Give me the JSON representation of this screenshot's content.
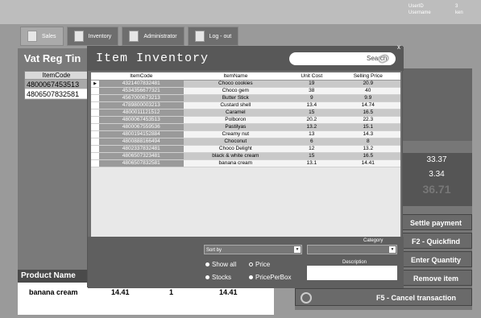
{
  "user": {
    "userid_label": "UserID",
    "userid": "3",
    "username_label": "Username",
    "username": "ken"
  },
  "nav": [
    {
      "label": "Sales",
      "icon": "document-icon"
    },
    {
      "label": "Inventory",
      "icon": "cart-icon"
    },
    {
      "label": "Administrator",
      "icon": "user-icon"
    },
    {
      "label": "Log - out",
      "icon": "logout-icon"
    }
  ],
  "left": {
    "title": "Vat Reg Tin",
    "header": "ItemCode",
    "rows": [
      "4800067453513",
      "4806507832581"
    ]
  },
  "modal": {
    "title": "Item Inventory",
    "close": "x",
    "search_placeholder": "Search",
    "columns": [
      "ItemCode",
      "ItemName",
      "Unit Cost",
      "Selling Price"
    ],
    "rows": [
      [
        "4321407832481",
        "Choco cookies",
        "19",
        "20.9"
      ],
      [
        "4534356677321",
        "Choco gem",
        "38",
        "40"
      ],
      [
        "4567000673213",
        "Butter Stick",
        "9",
        "9.9"
      ],
      [
        "4789800003213",
        "Custard shell",
        "13.4",
        "14.74"
      ],
      [
        "4800011121512",
        "Caramel",
        "15",
        "16.5"
      ],
      [
        "4800067453513",
        "Polboron",
        "20.2",
        "22.3"
      ],
      [
        "4800067559536",
        "Pastilyas",
        "13.2",
        "15.1"
      ],
      [
        "4800194152884",
        "Creamy nut",
        "13",
        "14.3"
      ],
      [
        "4800888166494",
        "Choconut",
        "6",
        "8"
      ],
      [
        "4802337832481",
        "Choco Delight",
        "12",
        "13.2"
      ],
      [
        "4806507323481",
        "black & white cream",
        "15",
        "16.5"
      ],
      [
        "4806507832581",
        "banana cream",
        "13.1",
        "14.41"
      ]
    ],
    "sort_label": "Sort by",
    "category_label": "Category",
    "description_label": "Description",
    "radios": [
      "Show all",
      "Price",
      "Stocks",
      "PricePerBox"
    ]
  },
  "product": {
    "header": "Product Name",
    "name": "banana cream",
    "price": "14.41",
    "qty": "1",
    "total": "14.41"
  },
  "totals": {
    "a": "33.37",
    "b": "3.34",
    "c": "36.71"
  },
  "actions": [
    "Settle payment",
    "F2 - Quickfind",
    "Enter Quantity",
    "Remove item"
  ],
  "cancel": "F5 - Cancel transaction"
}
